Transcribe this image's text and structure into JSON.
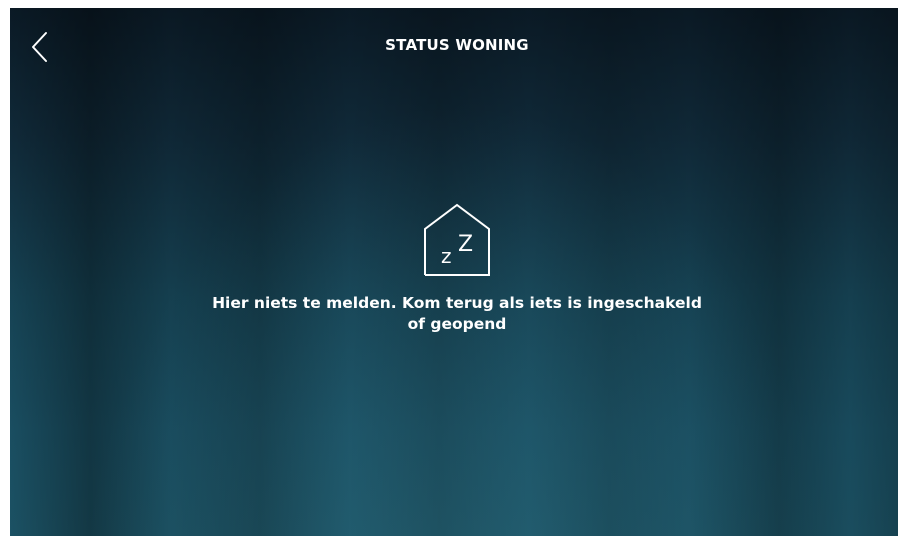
{
  "header": {
    "title": "STATUS WONING",
    "back_icon": "chevron-left-icon"
  },
  "empty_state": {
    "icon": "house-sleeping-icon",
    "icon_text_small": "z",
    "icon_text_large": "Z",
    "message_line1": "Hier niets te melden. Kom terug als iets is ingeschakeld",
    "message_line2": "of geopend"
  },
  "colors": {
    "background_top": "#0b1b27",
    "background_bottom": "#1d5669",
    "foreground": "#ffffff"
  }
}
